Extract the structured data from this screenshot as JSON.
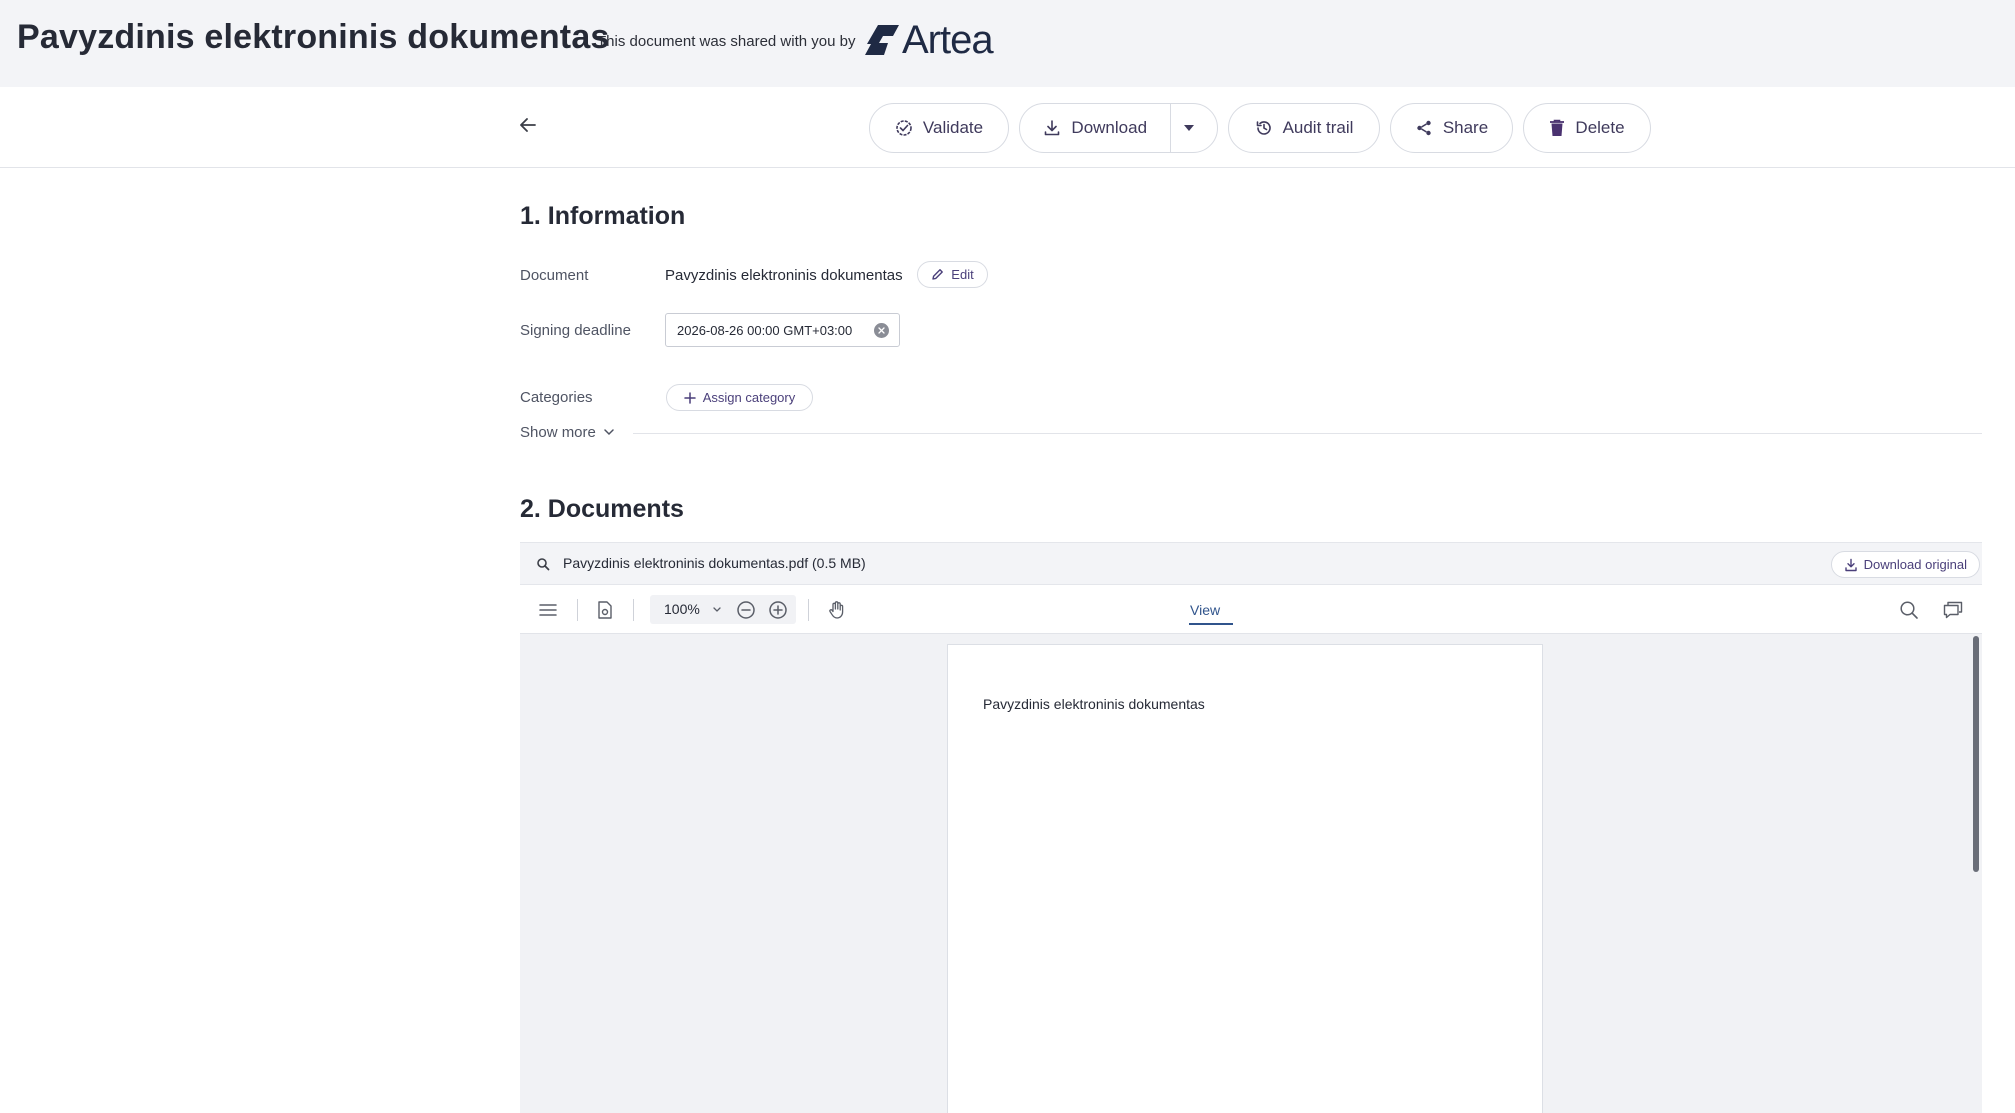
{
  "header": {
    "title": "Pavyzdinis elektroninis dokumentas",
    "shared_text": "This document was shared with you by",
    "brand_name": "Artea",
    "brand_icon": "artea-logo-icon"
  },
  "toolbar": {
    "back_icon": "arrow-left-icon",
    "validate_label": "Validate",
    "download_label": "Download",
    "audit_trail_label": "Audit trail",
    "share_label": "Share",
    "delete_label": "Delete"
  },
  "information": {
    "section_title": "1. Information",
    "document_label": "Document",
    "document_value": "Pavyzdinis elektroninis dokumentas",
    "edit_label": "Edit",
    "deadline_label": "Signing deadline",
    "deadline_value": "2026-08-26 00:00 GMT+03:00",
    "categories_label": "Categories",
    "assign_category_label": "Assign category",
    "show_more_label": "Show more"
  },
  "documents": {
    "section_title": "2. Documents",
    "file_name": "Pavyzdinis elektroninis dokumentas.pdf (0.5 MB)",
    "download_original_label": "Download original",
    "viewer": {
      "zoom_value": "100%",
      "active_tab": "View",
      "page_text": "Pavyzdinis elektroninis dokumentas"
    }
  },
  "colors": {
    "accent": "#3f3a5c",
    "tab_active": "#30548c",
    "header_bg": "#f3f4f7",
    "brand": "#1f2a44"
  }
}
